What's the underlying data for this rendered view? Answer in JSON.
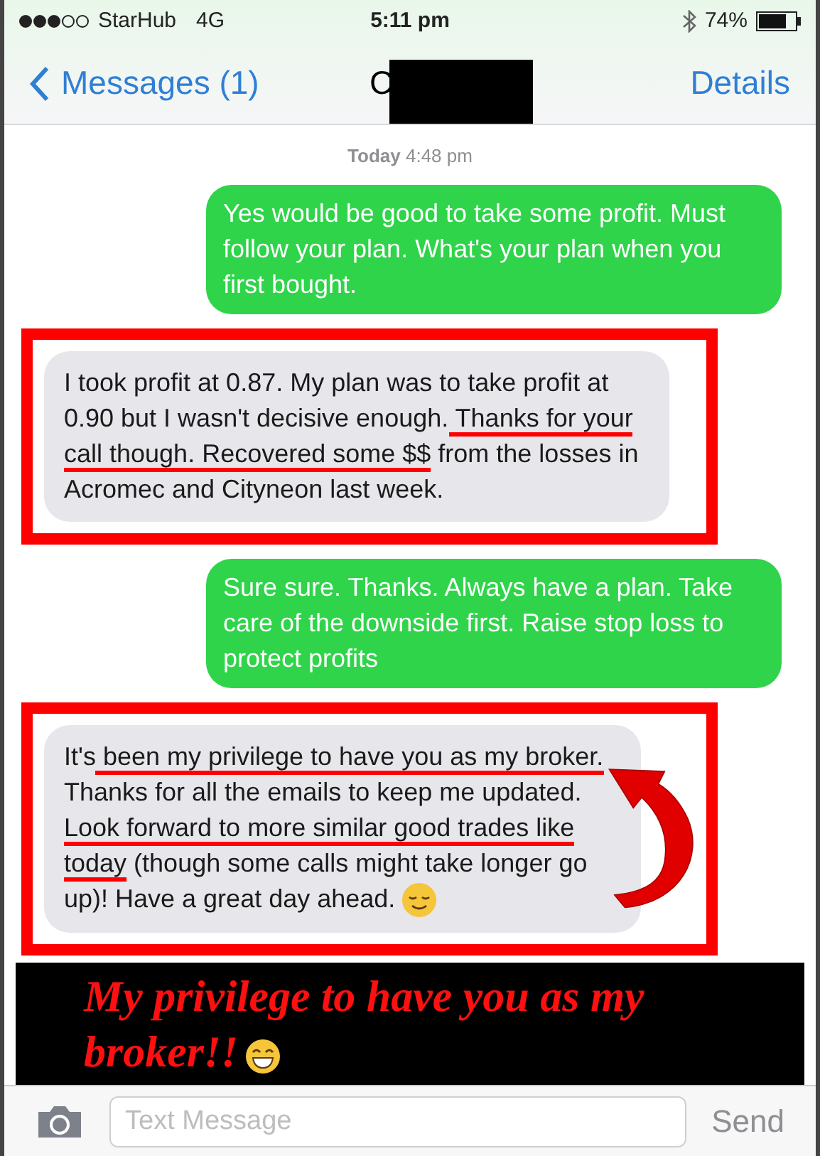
{
  "status_bar": {
    "carrier": "StarHub",
    "network": "4G",
    "time": "5:11 pm",
    "battery": "74%"
  },
  "nav": {
    "back": "Messages (1)",
    "title": "C",
    "action": "Details"
  },
  "timestamp": {
    "day": "Today",
    "time": "4:48 pm"
  },
  "messages": [
    {
      "kind": "sent",
      "segments": [
        {
          "text": "Yes would be good to take some profit. Must follow your plan. What's your plan when you first bought.",
          "underlined": false
        }
      ]
    },
    {
      "kind": "received",
      "framed": true,
      "segments": [
        {
          "text": "I took profit at 0.87. My plan was to take profit at 0.90 but I wasn't decisive enough.",
          "underlined": false
        },
        {
          "text": " Thanks for your call though. Recovered some $$",
          "underlined": true
        },
        {
          "text": " from the losses in Acromec and Cityneon last week.",
          "underlined": false
        }
      ]
    },
    {
      "kind": "sent",
      "segments": [
        {
          "text": "Sure sure. Thanks. Always have a plan. Take care of the downside first. Raise stop loss to protect profits",
          "underlined": false
        }
      ]
    },
    {
      "kind": "received",
      "framed": true,
      "emoji": true,
      "segments": [
        {
          "text": "It's",
          "underlined": false
        },
        {
          "text": " been my privilege to have you as my broker.",
          "underlined": true
        },
        {
          "text": " Thanks for all the emails to keep me updated.",
          "underlined": false
        },
        {
          "text": " Look forward to more similar good trades like today",
          "underlined": true
        },
        {
          "text": " (though some calls might take longer go up)! Have a great day ahead.",
          "underlined": false
        }
      ]
    }
  ],
  "banner": {
    "text": "My privilege to have you as my broker!!"
  },
  "composer": {
    "placeholder": "Text Message",
    "send": "Send"
  }
}
